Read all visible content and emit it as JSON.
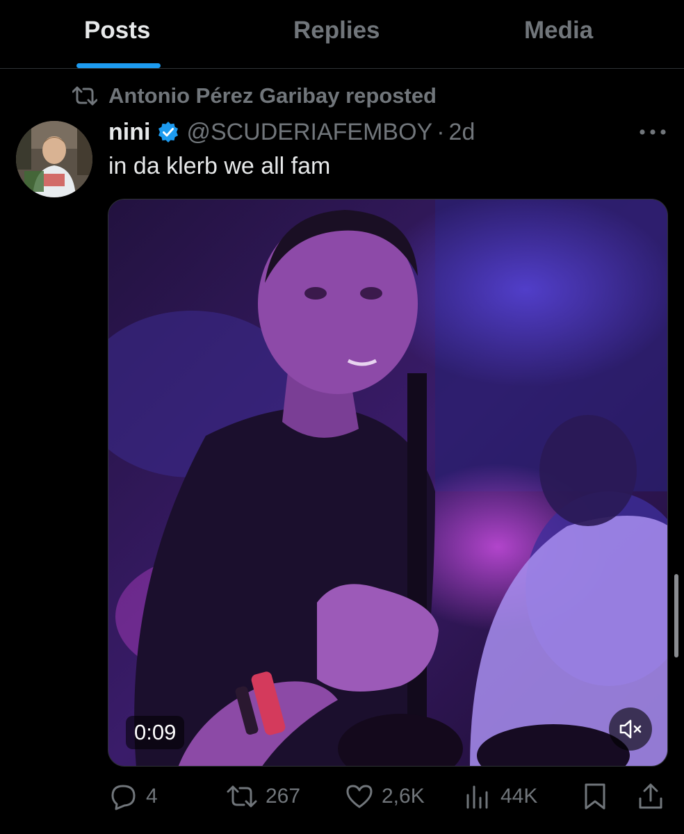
{
  "tabs": [
    {
      "label": "Posts",
      "active": true
    },
    {
      "label": "Replies",
      "active": false
    },
    {
      "label": "Media",
      "active": false
    }
  ],
  "colors": {
    "background": "#000000",
    "accent": "#1d9bf0",
    "text_primary": "#e7e9ea",
    "text_secondary": "#71767b",
    "divider": "#2f3336"
  },
  "repost": {
    "text": "Antonio Pérez Garibay reposted",
    "icon": "repost-icon"
  },
  "tweet": {
    "name": "nini",
    "verified": true,
    "handle": "@SCUDERIAFEMBOY",
    "separator": "·",
    "time": "2d",
    "text": "in da klerb we all fam",
    "media": {
      "type": "video",
      "duration": "0:09",
      "muted": true
    }
  },
  "actions": {
    "replies": "4",
    "reposts": "267",
    "likes": "2,6K",
    "views": "44K"
  }
}
